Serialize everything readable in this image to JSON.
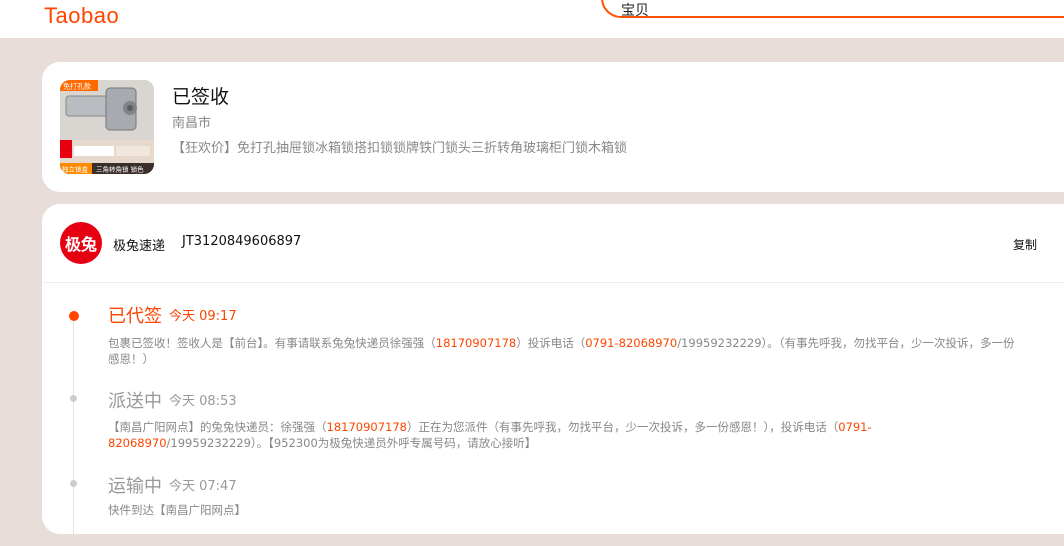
{
  "header": {
    "logo_text": "Taobao",
    "search_value": "宝贝"
  },
  "order": {
    "status": "已签收",
    "city": "南昌市",
    "title": "【狂欢价】免打孔抽屉锁冰箱锁搭扣锁锁牌铁门锁头三折转角玻璃柜门锁木箱锁",
    "thumb_badge": "免打孔款",
    "thumb_caption_1": "独立锁盒",
    "thumb_caption_2": "三角转角锁 锁色"
  },
  "logistics": {
    "courier_logo": "极兔",
    "courier_name": "极兔速递",
    "tracking_number": "JT3120849606897",
    "copy_label": "复制",
    "events": [
      {
        "status": "已代签",
        "time": "今天 09:17",
        "desc_1": "包裹已签收！签收人是【前台】。有事请联系兔兔快递员徐强强（",
        "phone": "18170907178",
        "desc_2": "）投诉电话（",
        "complaint_phone": "0791-82068970",
        "desc_3": "/19959232229）。（有事先呼我，勿找平台，少一次投诉，多一份感恩！）"
      },
      {
        "status": "派送中",
        "time": "今天 08:53",
        "desc_1": "【南昌广阳网点】的兔兔快递员：徐强强（",
        "phone": "18170907178",
        "desc_2": "）正在为您派件（有事先呼我，勿找平台，少一次投诉，多一份感恩！），投诉电话（",
        "complaint_phone": "0791-82068970",
        "desc_3": "/19959232229）。【952300为极兔快递员外呼专属号码，请放心接听】"
      },
      {
        "status": "运输中",
        "time": "今天 07:47",
        "desc_1": "快件到达【南昌广阳网点】"
      }
    ]
  },
  "colors": {
    "accent": "#ff4400",
    "courier_red": "#e60012",
    "page_bg": "#e8ddd9"
  }
}
